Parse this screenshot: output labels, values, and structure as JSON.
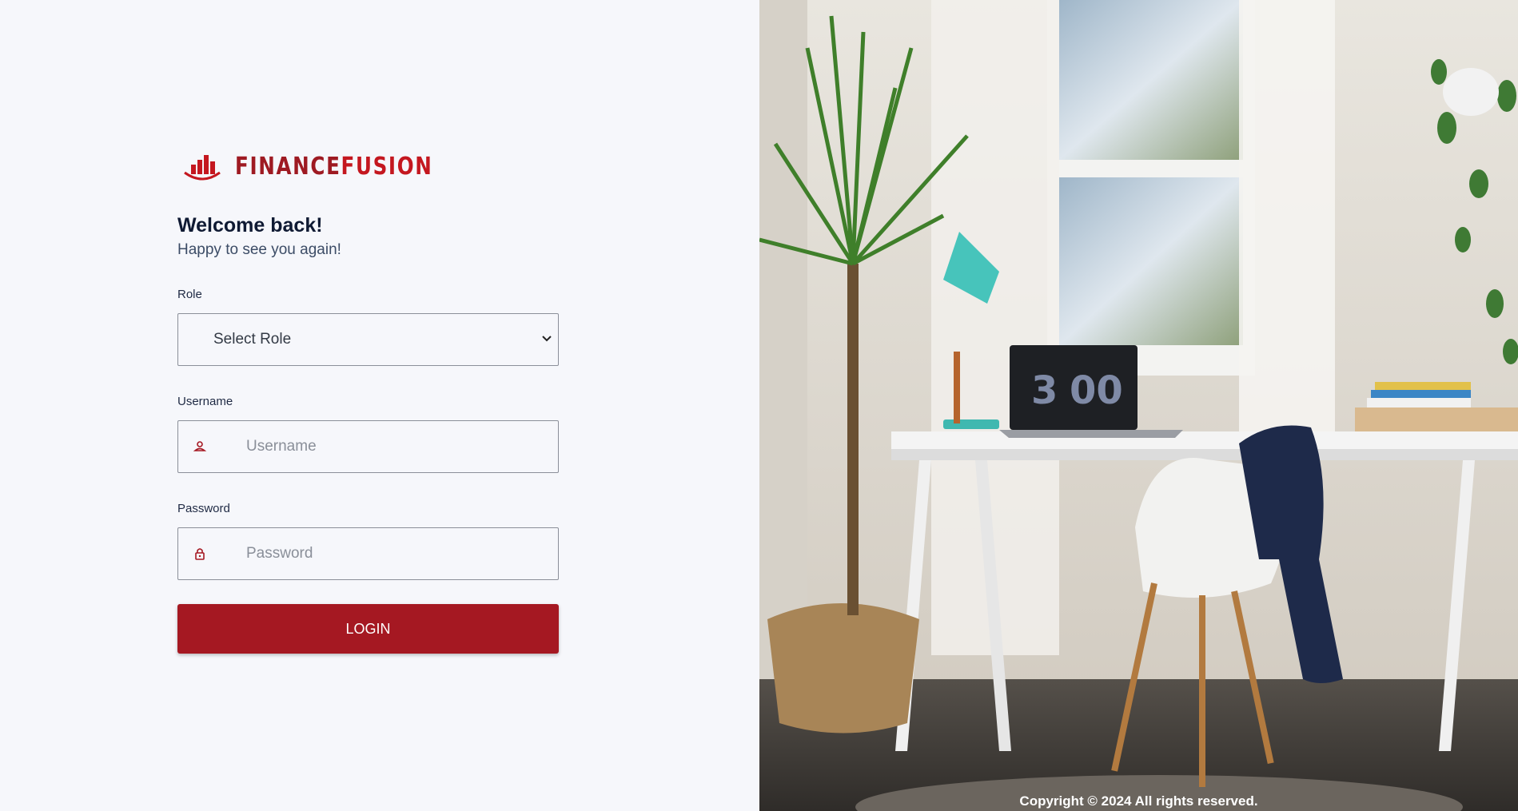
{
  "brand": {
    "name_part1": "FINANCE",
    "name_part2": "FUSION",
    "logo_icon": "bar-chart-icon",
    "color_primary": "#c4171f",
    "color_dark": "#9e1a22"
  },
  "login": {
    "heading": "Welcome back!",
    "subheading": "Happy to see you again!",
    "role": {
      "label": "Role",
      "selected": "Select Role",
      "icon": "chevron-down-icon"
    },
    "username": {
      "label": "Username",
      "placeholder": "Username",
      "icon": "user-icon"
    },
    "password": {
      "label": "Password",
      "placeholder": "Password",
      "icon": "lock-icon"
    },
    "submit_label": "LOGIN",
    "button_color": "#a51822"
  },
  "hero": {
    "clock_hours": "3",
    "clock_minutes": "00",
    "copyright": "Copyright © 2024 All rights reserved."
  }
}
